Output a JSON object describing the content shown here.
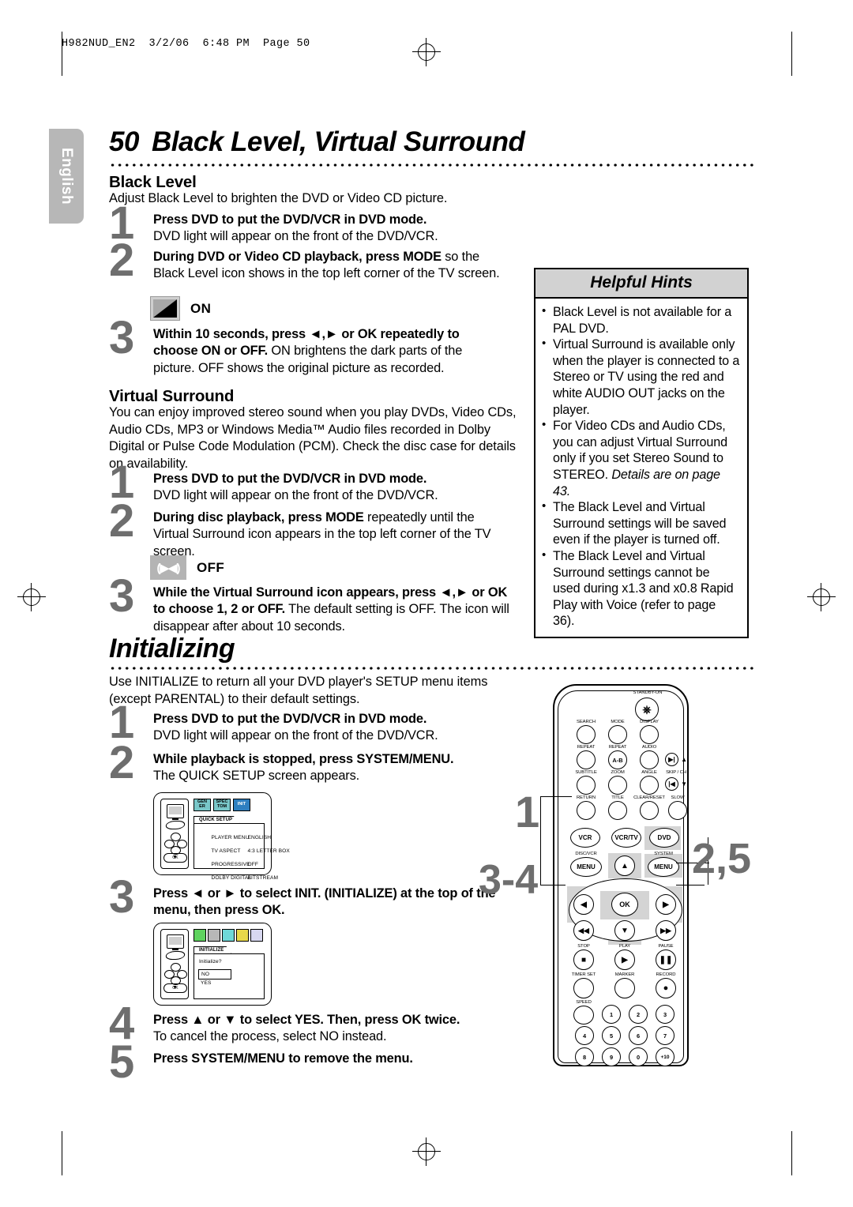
{
  "running_head": "H982NUD_EN2  3/2/06  6:48 PM  Page 50",
  "side_tab": "English",
  "title": {
    "number": "50",
    "text": "Black Level, Virtual Surround"
  },
  "black_level": {
    "heading": "Black Level",
    "intro": "Adjust Black Level to brighten the DVD or Video CD picture.",
    "steps": [
      {
        "num": "1",
        "bold": "Press DVD to put the DVD/VCR in DVD mode.",
        "rest": "DVD light will appear on the front of the DVD/VCR."
      },
      {
        "num": "2",
        "bold": "During DVD or Video CD playback, press MODE",
        "rest": "so the Black Level icon shows in the top left corner of the TV screen."
      },
      {
        "num": "3",
        "bold": "Within 10 seconds, press ◄,► or OK repeatedly to choose ON or OFF.",
        "rest": "ON brightens the dark parts of the picture. OFF shows the original picture as recorded."
      }
    ],
    "icon_label": "ON",
    "icon_name": "black-level-on-icon"
  },
  "virtual_surround": {
    "heading": "Virtual Surround",
    "intro": "You can enjoy improved stereo sound when you play DVDs, Video CDs, Audio CDs, MP3 or Windows Media™ Audio files recorded in Dolby Digital or Pulse Code Modulation (PCM). Check the disc case for details on availability.",
    "steps": [
      {
        "num": "1",
        "bold": "Press DVD to put the DVD/VCR in DVD mode.",
        "rest": "DVD light will appear on the front of the DVD/VCR."
      },
      {
        "num": "2",
        "bold": "During disc playback, press MODE",
        "rest": "repeatedly until the Virtual Surround icon appears in the top left corner of the TV screen."
      },
      {
        "num": "3",
        "bold": "While the Virtual Surround icon appears, press ◄,► or OK to choose 1, 2 or OFF.",
        "rest": "The default setting is OFF. The icon will disappear after about 10 seconds."
      }
    ],
    "icon_label": "OFF",
    "icon_glyph": "(▶◀)",
    "icon_name": "virtual-surround-off-icon"
  },
  "helpful_hints": {
    "title": "Helpful Hints",
    "items": [
      "Black Level is not available for a PAL DVD.",
      "Virtual Surround is available only when the player is connected to a Stereo or TV using the red and white AUDIO OUT jacks on the player.",
      "For Video CDs and Audio CDs, you can adjust Virtual Surround only if you set Stereo Sound to STEREO.",
      "The Black Level and Virtual Surround settings will be saved even if the player is turned off.",
      "The Black Level and Virtual Surround settings cannot be used during x1.3 and x0.8 Rapid Play with Voice (refer to page 36)."
    ],
    "italic_note": "Details are on page 43."
  },
  "initializing": {
    "heading": "Initializing",
    "intro": "Use INITIALIZE to return all your DVD player's SETUP menu items (except PARENTAL) to their default settings.",
    "steps": [
      {
        "num": "1",
        "bold": "Press DVD to put the DVD/VCR in DVD mode.",
        "rest": "DVD light will appear on the front of the DVD/VCR."
      },
      {
        "num": "2",
        "bold": "While playback is stopped, press SYSTEM/MENU.",
        "rest": "The QUICK SETUP screen appears."
      },
      {
        "num": "3",
        "bold": "Press ◄ or ► to select INIT. (INITIALIZE) at the top of the menu, then press OK.",
        "rest": ""
      },
      {
        "num": "4",
        "bold": "Press ▲ or ▼ to select YES. Then, press OK twice.",
        "rest": "To cancel the process, select NO instead."
      },
      {
        "num": "5",
        "bold": "Press SYSTEM/MENU to remove the menu.",
        "rest": ""
      }
    ]
  },
  "osd_quick_setup": {
    "tab_title": "QUICK SETUP",
    "tabs": [
      "GEN ER",
      "SPEC TOM",
      "INIT"
    ],
    "active_tab_index": 2,
    "ok_label": "OK",
    "rows": [
      {
        "label": "PLAYER MENU",
        "value": "ENGLISH"
      },
      {
        "label": "TV ASPECT",
        "value": "4:3 LETTER BOX"
      },
      {
        "label": "PROGRESSIVE",
        "value": "OFF"
      },
      {
        "label": "DOLBY DIGITAL",
        "value": "BITSTREAM"
      }
    ]
  },
  "osd_initialize": {
    "tab_title": "INITIALIZE",
    "prompt": "Initialize?",
    "options": [
      "NO",
      "YES"
    ],
    "selected_option": "NO",
    "ok_label": "OK",
    "tab_count": 6,
    "active_tab_index": 5
  },
  "remote": {
    "standby_label": "STANDBY-ON",
    "rows": [
      {
        "caps": [
          "SEARCH",
          "MODE",
          "DISPLAY"
        ]
      },
      {
        "caps": [
          "REPEAT",
          "REPEAT",
          "AUDIO"
        ],
        "extra": "A-B"
      },
      {
        "caps": [
          "SUBTITLE",
          "ZOOM",
          "ANGLE",
          "SKIP / CH"
        ]
      },
      {
        "caps": [
          "RETURN",
          "TITLE",
          "CLEAR/RESET",
          "SLOW"
        ]
      }
    ],
    "mode_buttons": [
      "VCR",
      "VCR/TV",
      "DVD"
    ],
    "menu_left_cap": "DISC/VCR",
    "menu_right_cap": "SYSTEM",
    "menu_label": "MENU",
    "ok_label": "OK",
    "transport_caps": [
      "STOP",
      "PLAY",
      "PAUSE"
    ],
    "record_caps": [
      "TIMER SET",
      "MARKER",
      "RECORD"
    ],
    "speed_cap": "SPEED",
    "numbers": [
      "1",
      "2",
      "3",
      "4",
      "5",
      "6",
      "7",
      "8",
      "9",
      "0",
      "+10"
    ],
    "callouts": {
      "top_left": "1",
      "mid_left": "3-4",
      "right": "2,5"
    }
  },
  "colors": {
    "gray_number": "#6e6e6e",
    "tab_gray": "#b7b7b7",
    "hint_header": "#d2d2d2"
  }
}
